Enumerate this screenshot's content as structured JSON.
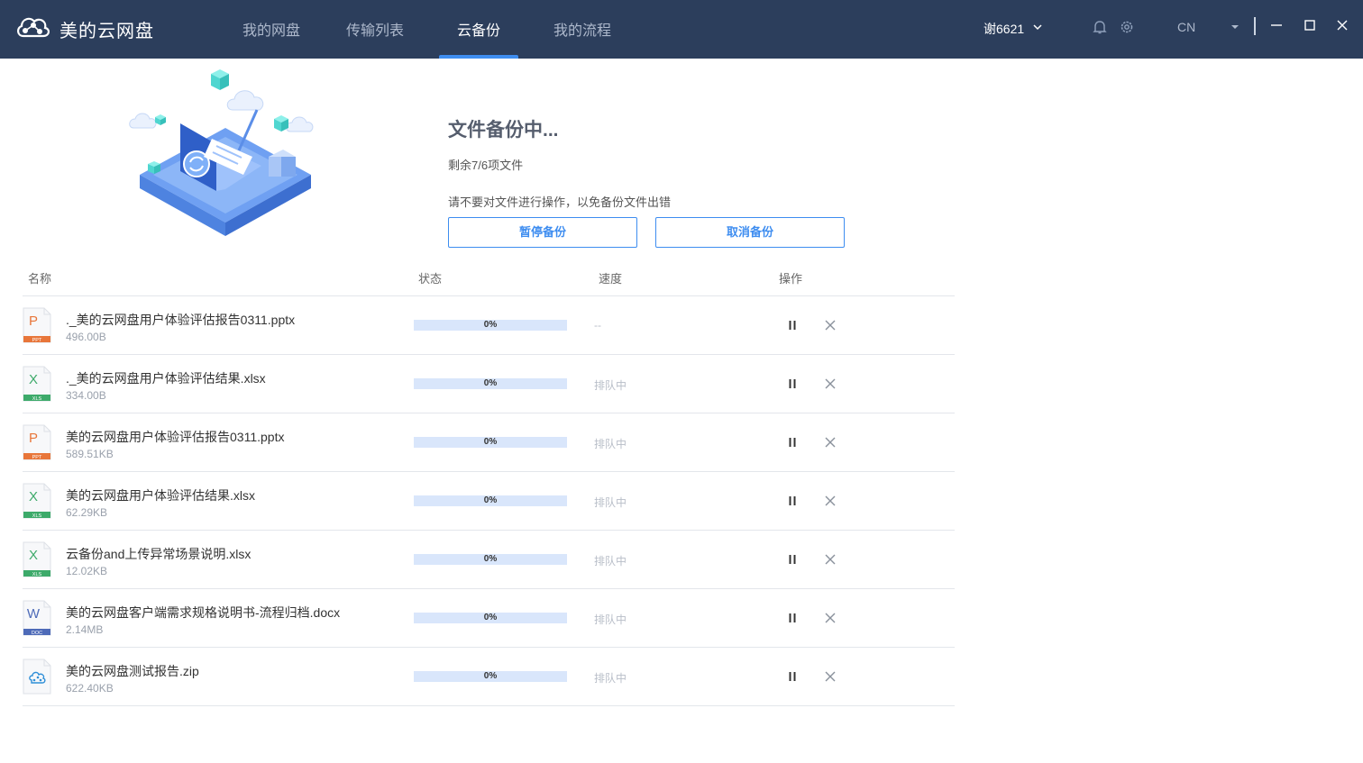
{
  "app": {
    "title": "美的云网盘"
  },
  "nav": {
    "tabs": [
      {
        "label": "我的网盘",
        "active": false
      },
      {
        "label": "传输列表",
        "active": false
      },
      {
        "label": "云备份",
        "active": true
      },
      {
        "label": "我的流程",
        "active": false
      }
    ]
  },
  "header": {
    "user": "谢6621",
    "language": "CN"
  },
  "backup": {
    "title": "文件备份中...",
    "remaining": "剩余7/6项文件",
    "warning": "请不要对文件进行操作，以免备份文件出错",
    "pause_label": "暂停备份",
    "cancel_label": "取消备份"
  },
  "table": {
    "headers": {
      "name": "名称",
      "status": "状态",
      "speed": "速度",
      "action": "操作"
    },
    "rows": [
      {
        "name": "._美的云网盘用户体验评估报告0311.pptx",
        "size": "496.00B",
        "type": "ppt",
        "type_label": "PPT",
        "letter": "P",
        "progress": 0,
        "progress_text": "0%",
        "speed": "--"
      },
      {
        "name": "._美的云网盘用户体验评估结果.xlsx",
        "size": "334.00B",
        "type": "xls",
        "type_label": "XLS",
        "letter": "X",
        "progress": 0,
        "progress_text": "0%",
        "speed": "排队中"
      },
      {
        "name": "美的云网盘用户体验评估报告0311.pptx",
        "size": "589.51KB",
        "type": "ppt",
        "type_label": "PPT",
        "letter": "P",
        "progress": 0,
        "progress_text": "0%",
        "speed": "排队中"
      },
      {
        "name": "美的云网盘用户体验评估结果.xlsx",
        "size": "62.29KB",
        "type": "xls",
        "type_label": "XLS",
        "letter": "X",
        "progress": 0,
        "progress_text": "0%",
        "speed": "排队中"
      },
      {
        "name": "云备份and上传异常场景说明.xlsx",
        "size": "12.02KB",
        "type": "xls",
        "type_label": "XLS",
        "letter": "X",
        "progress": 0,
        "progress_text": "0%",
        "speed": "排队中"
      },
      {
        "name": "美的云网盘客户端需求规格说明书-流程归档.docx",
        "size": "2.14MB",
        "type": "doc",
        "type_label": "DOC",
        "letter": "W",
        "progress": 0,
        "progress_text": "0%",
        "speed": "排队中"
      },
      {
        "name": "美的云网盘测试报告.zip",
        "size": "622.40KB",
        "type": "zip",
        "type_label": "",
        "letter": "",
        "progress": 0,
        "progress_text": "0%",
        "speed": "排队中"
      }
    ]
  },
  "colors": {
    "topbar": "#2c3e5c",
    "accent": "#3e8df0",
    "ppt": "#e8763a",
    "xls": "#3daa6a",
    "doc": "#4e6bb8",
    "zip": "#2f8fd8"
  }
}
